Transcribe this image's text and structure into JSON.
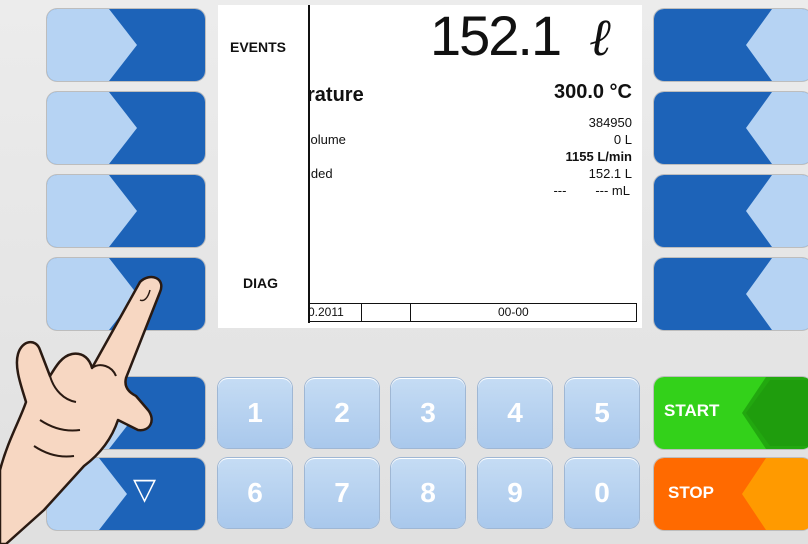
{
  "screen": {
    "big_volume": "152.1",
    "big_unit": "ℓ",
    "left_label_top": "EVENTS",
    "left_label_bottom": "DIAG",
    "temperature_label": "rature",
    "temperature_value": "300.0 °C",
    "rows": [
      {
        "label": "",
        "value": "384950"
      },
      {
        "label": "'olume",
        "value": "0 L"
      },
      {
        "label": "",
        "value": "1155 L/min"
      },
      {
        "label": "ided",
        "value": "152.1 L"
      },
      {
        "label": "",
        "value": "---        --- mL"
      }
    ],
    "footer_date": "0.2011",
    "footer_code": "00-00"
  },
  "keypad": {
    "numbers_top": [
      "1",
      "2",
      "3",
      "4",
      "5"
    ],
    "numbers_bottom": [
      "6",
      "7",
      "8",
      "9",
      "0"
    ],
    "down_arrow": "▽",
    "start_label": "START",
    "stop_label": "STOP"
  },
  "colors": {
    "softkey_dark": "#1d63b8",
    "softkey_light": "#b6d3f3",
    "start_green": "#33d11a",
    "stop_orange": "#ff6a00"
  }
}
